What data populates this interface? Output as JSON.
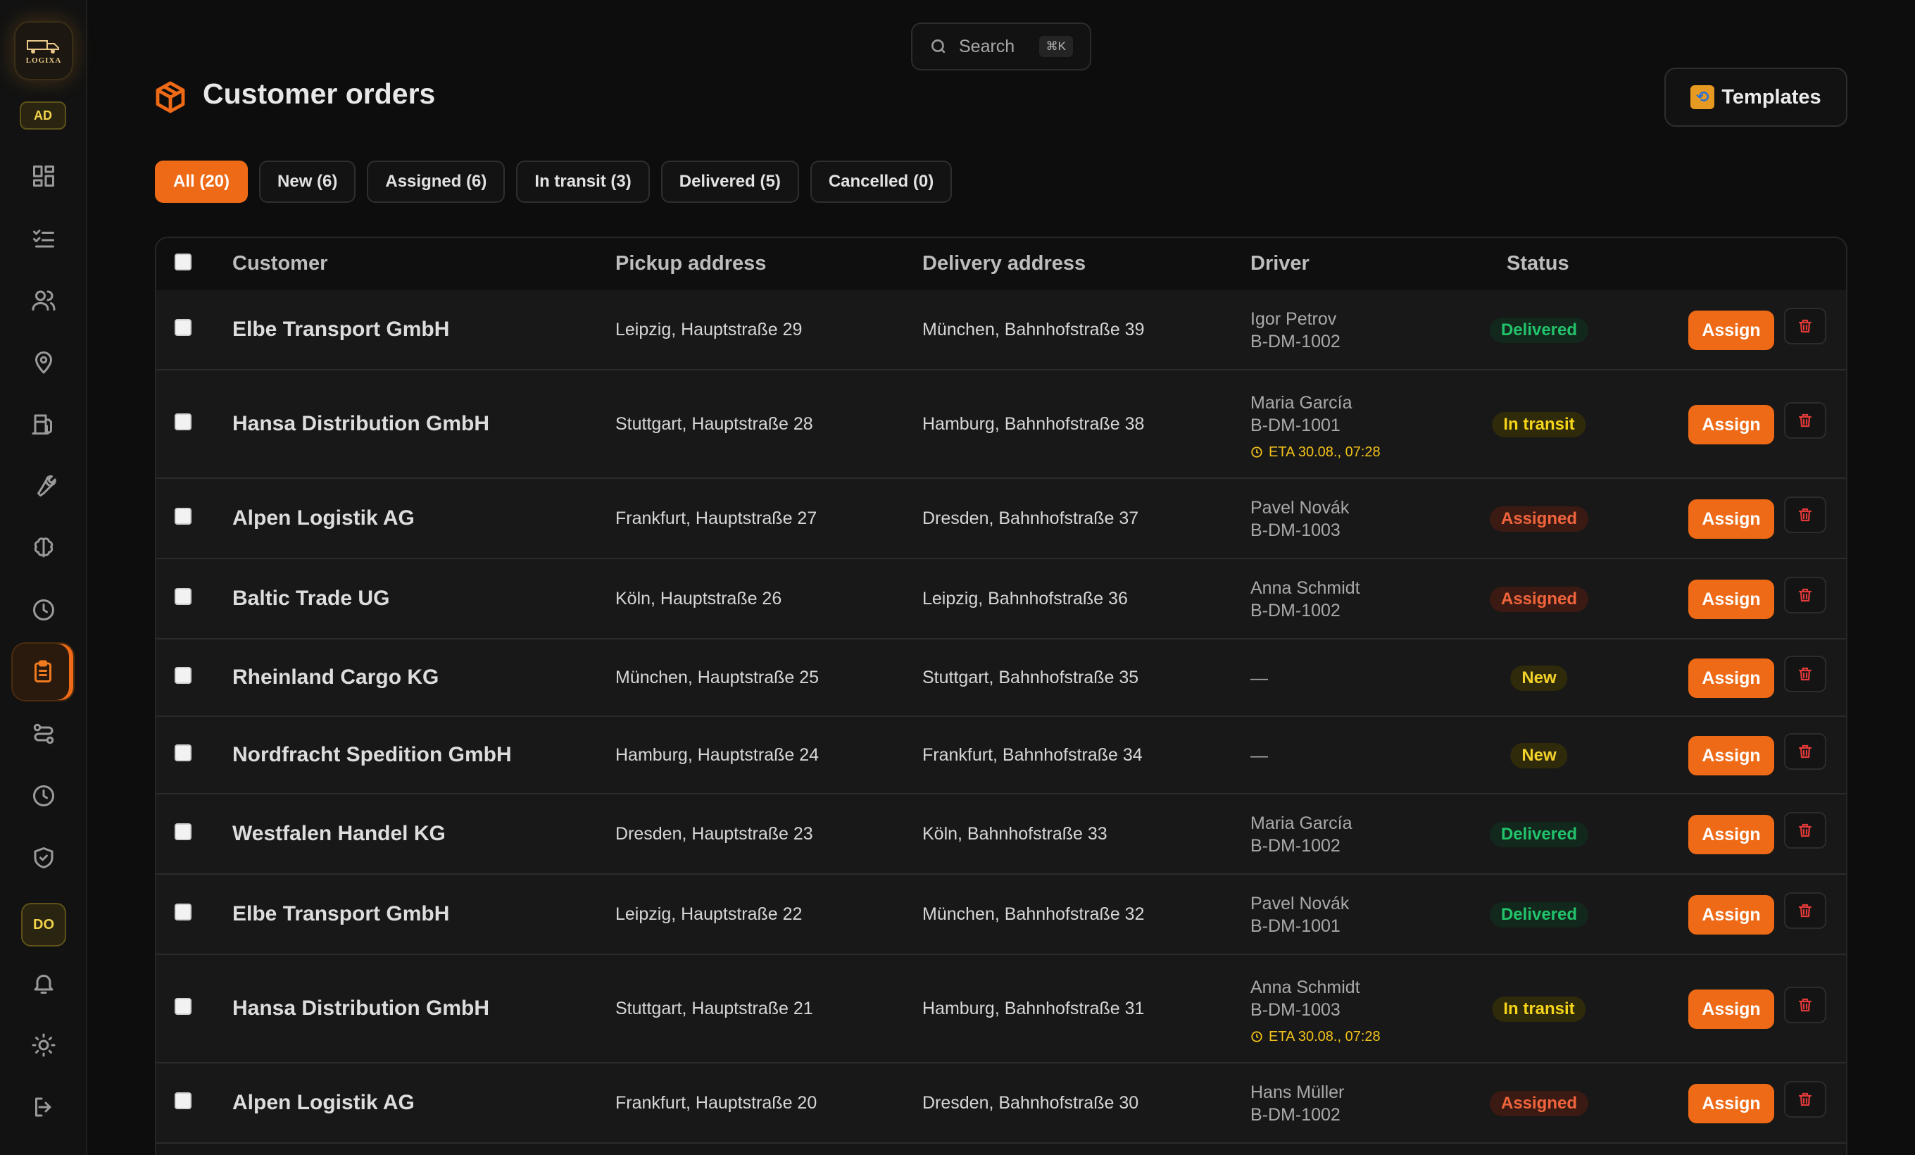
{
  "app": {
    "logo_text": "LOGIXA"
  },
  "sidebar": {
    "user_initials_top": "AD",
    "user_initials_bottom": "DO",
    "items": [
      {
        "icon": "dashboard-icon"
      },
      {
        "icon": "checklist-icon"
      },
      {
        "icon": "users-icon"
      },
      {
        "icon": "location-pin-icon"
      },
      {
        "icon": "fuel-station-icon"
      },
      {
        "icon": "wrench-icon"
      },
      {
        "icon": "brain-icon"
      },
      {
        "icon": "clock-icon"
      },
      {
        "icon": "clipboard-icon",
        "active": true
      },
      {
        "icon": "route-icon"
      },
      {
        "icon": "history-icon"
      },
      {
        "icon": "shield-check-icon"
      },
      {
        "icon": "bell-icon"
      },
      {
        "icon": "sun-icon"
      },
      {
        "icon": "logout-icon"
      }
    ]
  },
  "search": {
    "placeholder": "Search",
    "shortcut": "⌘K"
  },
  "header": {
    "title": "Customer orders",
    "templates_label": "Templates"
  },
  "tabs": [
    {
      "label": "All (20)",
      "active": true
    },
    {
      "label": "New (6)"
    },
    {
      "label": "Assigned (6)"
    },
    {
      "label": "In transit (3)"
    },
    {
      "label": "Delivered (5)"
    },
    {
      "label": "Cancelled (0)"
    }
  ],
  "table": {
    "columns": [
      "Customer",
      "Pickup address",
      "Delivery address",
      "Driver",
      "Status"
    ],
    "assign_label": "Assign",
    "rows": [
      {
        "customer": "Elbe Transport GmbH",
        "pickup": "Leipzig, Hauptstraße 29",
        "delivery": "München, Bahnhofstraße 39",
        "driver": "Igor Petrov",
        "plate": "B-DM-1002",
        "eta": "",
        "status": "Delivered",
        "status_kind": "delivered"
      },
      {
        "customer": "Hansa Distribution GmbH",
        "pickup": "Stuttgart, Hauptstraße 28",
        "delivery": "Hamburg, Bahnhofstraße 38",
        "driver": "Maria García",
        "plate": "B-DM-1001",
        "eta": "ETA 30.08., 07:28",
        "status": "In transit",
        "status_kind": "transit"
      },
      {
        "customer": "Alpen Logistik AG",
        "pickup": "Frankfurt, Hauptstraße 27",
        "delivery": "Dresden, Bahnhofstraße 37",
        "driver": "Pavel Novák",
        "plate": "B-DM-1003",
        "eta": "",
        "status": "Assigned",
        "status_kind": "assigned"
      },
      {
        "customer": "Baltic Trade UG",
        "pickup": "Köln, Hauptstraße 26",
        "delivery": "Leipzig, Bahnhofstraße 36",
        "driver": "Anna Schmidt",
        "plate": "B-DM-1002",
        "eta": "",
        "status": "Assigned",
        "status_kind": "assigned"
      },
      {
        "customer": "Rheinland Cargo KG",
        "pickup": "München, Hauptstraße 25",
        "delivery": "Stuttgart, Bahnhofstraße 35",
        "driver": "—",
        "plate": "",
        "eta": "",
        "status": "New",
        "status_kind": "new"
      },
      {
        "customer": "Nordfracht Spedition GmbH",
        "pickup": "Hamburg, Hauptstraße 24",
        "delivery": "Frankfurt, Bahnhofstraße 34",
        "driver": "—",
        "plate": "",
        "eta": "",
        "status": "New",
        "status_kind": "new"
      },
      {
        "customer": "Westfalen Handel KG",
        "pickup": "Dresden, Hauptstraße 23",
        "delivery": "Köln, Bahnhofstraße 33",
        "driver": "Maria García",
        "plate": "B-DM-1002",
        "eta": "",
        "status": "Delivered",
        "status_kind": "delivered"
      },
      {
        "customer": "Elbe Transport GmbH",
        "pickup": "Leipzig, Hauptstraße 22",
        "delivery": "München, Bahnhofstraße 32",
        "driver": "Pavel Novák",
        "plate": "B-DM-1001",
        "eta": "",
        "status": "Delivered",
        "status_kind": "delivered"
      },
      {
        "customer": "Hansa Distribution GmbH",
        "pickup": "Stuttgart, Hauptstraße 21",
        "delivery": "Hamburg, Bahnhofstraße 31",
        "driver": "Anna Schmidt",
        "plate": "B-DM-1003",
        "eta": "ETA 30.08., 07:28",
        "status": "In transit",
        "status_kind": "transit"
      },
      {
        "customer": "Alpen Logistik AG",
        "pickup": "Frankfurt, Hauptstraße 20",
        "delivery": "Dresden, Bahnhofstraße 30",
        "driver": "Hans Müller",
        "plate": "B-DM-1002",
        "eta": "",
        "status": "Assigned",
        "status_kind": "assigned"
      }
    ]
  },
  "colors": {
    "accent": "#ef6a16",
    "delivered": "#22c36b",
    "transit": "#f5d41a",
    "assigned": "#f0643c"
  }
}
